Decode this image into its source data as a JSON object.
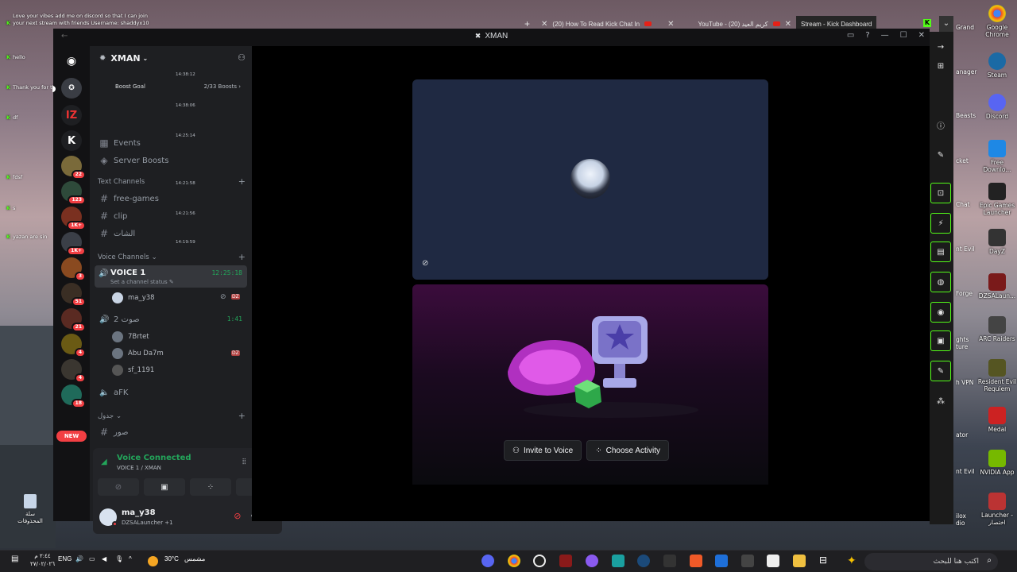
{
  "chat_overlay": {
    "messages": [
      {
        "user": "shaddyx10",
        "text": "Love your vibes add me on discord so that I can join your next stream with friends Username: shaddyx10"
      },
      {
        "user": "",
        "text": "hello"
      },
      {
        "user": "",
        "text": "Thank you for the follow @Shaddyx10"
      },
      {
        "user": "",
        "text": "df"
      },
      {
        "user": "",
        "text": "fdsf"
      },
      {
        "user": "",
        "text": "s"
      },
      {
        "user": "",
        "text": "yazan are sin"
      }
    ]
  },
  "browser": {
    "tabs": [
      {
        "label": "(20) How To Read Kick Chat In",
        "active": false
      },
      {
        "label": "YouTube - (20) كريم العيد",
        "active": false
      },
      {
        "label": "Stream - Kick Dashboard",
        "active": true
      }
    ],
    "sidebar_icons": [
      "forward-icon",
      "grid-icon",
      "info-icon",
      "pencil-icon",
      "capture-icon",
      "bolt-icon",
      "document-icon",
      "chat-bubble-icon",
      "broadcast-icon",
      "gift-icon",
      "wrench-icon",
      "share-icon"
    ]
  },
  "window": {
    "title": "XMAN",
    "title_icon": "screen-share-icon"
  },
  "server_list": {
    "badges": [
      "22",
      "123",
      "1K+",
      "1K+",
      "3",
      "51",
      "21",
      "4",
      "4",
      "18"
    ],
    "new_label": "NEW"
  },
  "channel_sidebar": {
    "server_name": "XMAN",
    "boost_goal": {
      "label": "Boost Goal",
      "count": "2/33 Boosts"
    },
    "top_items": [
      {
        "label": "Events",
        "icon": "calendar-icon"
      },
      {
        "label": "Server Boosts",
        "icon": "boost-gem-icon"
      }
    ],
    "text_category": "Text Channels",
    "text_channels": [
      "free-games",
      "clip",
      "الشات"
    ],
    "voice_category": "Voice Channels",
    "voice1": {
      "name": "VOICE 1",
      "status": "Set a channel status",
      "timer": "12:25:18",
      "users": [
        "ma_y38"
      ]
    },
    "voice2": {
      "name": "صوت 2",
      "timer": "1:41",
      "users": [
        "7Brtet",
        "Abu Da7m",
        "sf_1191"
      ]
    },
    "afk": "aFK",
    "other_category": "جدول",
    "other_channel": "صور",
    "timestamps": [
      "14:38:12",
      "14:38:06",
      "14:25:14",
      "14:21:58",
      "14:21:56",
      "14:19:59"
    ]
  },
  "voice_panel": {
    "status": "Voice Connected",
    "location": "VOICE 1 / XMAN"
  },
  "user_area": {
    "username": "ma_y38",
    "activity": "DZSALauncher +1"
  },
  "stage": {
    "buttons": {
      "invite": "Invite to Voice",
      "activity": "Choose Activity"
    }
  },
  "desktop_icons": [
    {
      "label": "Google Chrome"
    },
    {
      "label": "Steam"
    },
    {
      "label": "Discord"
    },
    {
      "label": "Free Downlo..."
    },
    {
      "label": "Epic Games Launcher"
    },
    {
      "label": "DayZ"
    },
    {
      "label": "DZSALaun..."
    },
    {
      "label": "ARC Raiders"
    },
    {
      "label": "Resident Evil Requiem"
    },
    {
      "label": "Medal"
    },
    {
      "label": "NVIDIA App"
    },
    {
      "label": "Launcher - اختصار"
    }
  ],
  "desktop_partial_labels": [
    "Grand",
    "Grand",
    "anager",
    "Beasts",
    "cket",
    "Chat",
    "nt Evil",
    "Forge",
    "ghts",
    "ture",
    "h VPN",
    "ator",
    "nt Evil",
    "ilox",
    "dio"
  ],
  "recycle_bin": "سلة المحذوفات",
  "taskbar": {
    "time": "٢:٤٤ م",
    "date": "٢٧/٠٢/٠٢٦",
    "language": "ENG",
    "weather_temp": "30°C",
    "weather_text": "مشمس",
    "search_placeholder": "اكتب هنا للبحث"
  },
  "colors": {
    "discord_bg": "#1a1a1e",
    "voice_green": "#23a55a",
    "badge_red": "#f23f43",
    "kick_green": "#53fc18",
    "tile_blue": "#1f2942"
  }
}
